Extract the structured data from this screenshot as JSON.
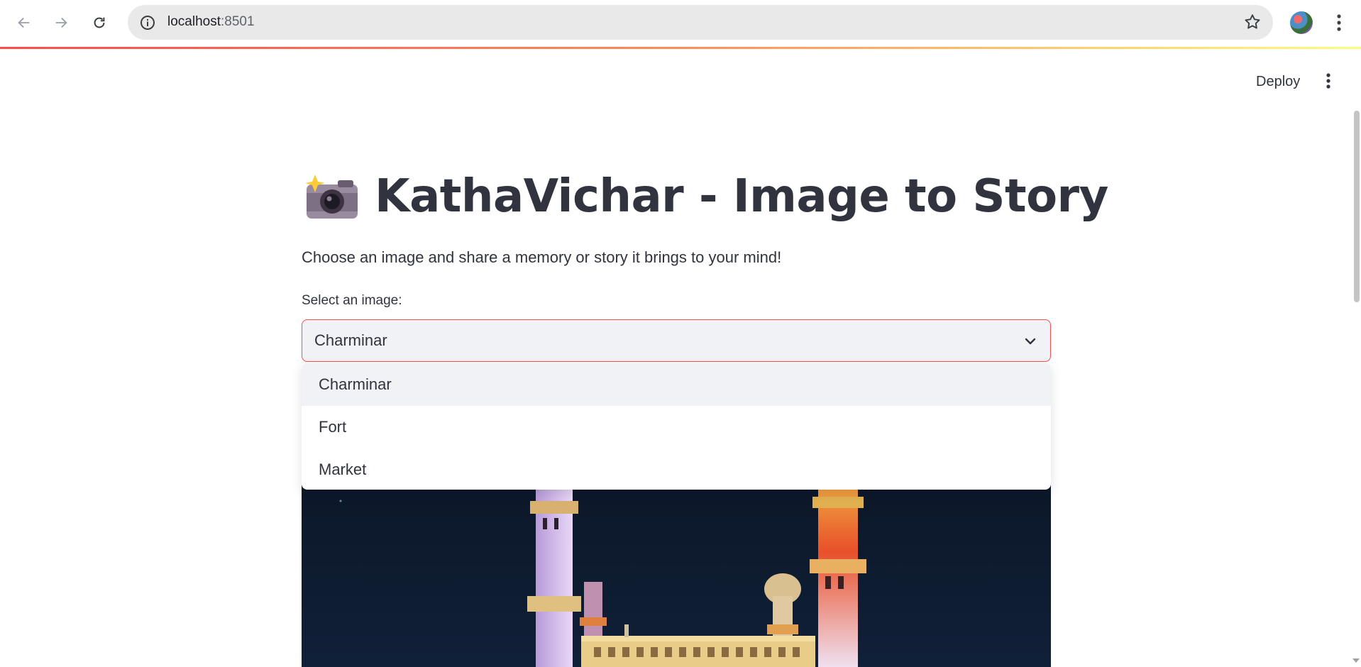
{
  "browser": {
    "url_host": "localhost",
    "url_port": ":8501"
  },
  "header": {
    "deploy_label": "Deploy"
  },
  "main": {
    "title": "KathaVichar - Image to Story",
    "title_icon": "camera-with-flash-icon",
    "subtitle": "Choose an image and share a memory or story it brings to your mind!",
    "select_label": "Select an image:",
    "selected_value": "Charminar",
    "options": [
      "Charminar",
      "Fort",
      "Market"
    ]
  },
  "colors": {
    "accent": "#ff4b4b",
    "text": "#31333f",
    "input_bg": "#f0f2f6",
    "image_sky": "#0b1322"
  }
}
